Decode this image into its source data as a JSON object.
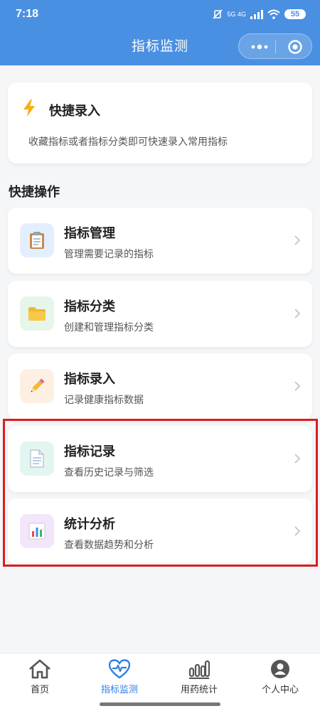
{
  "status_bar": {
    "time": "7:18",
    "network": "5G 4G",
    "battery": "55"
  },
  "header": {
    "title": "指标监测"
  },
  "quick_entry": {
    "icon": "lightning-icon",
    "title": "快捷录入",
    "description": "收藏指标或者指标分类即可快速录入常用指标"
  },
  "section_title": "快捷操作",
  "actions": [
    {
      "title": "指标管理",
      "description": "管理需要记录的指标",
      "icon": "clipboard-icon",
      "icon_bg": "#e3efff"
    },
    {
      "title": "指标分类",
      "description": "创建和管理指标分类",
      "icon": "folder-icon",
      "icon_bg": "#e6f6ea"
    },
    {
      "title": "指标录入",
      "description": "记录健康指标数据",
      "icon": "pencil-icon",
      "icon_bg": "#fdf0e3"
    },
    {
      "title": "指标记录",
      "description": "查看历史记录与筛选",
      "icon": "document-icon",
      "icon_bg": "#e3f5f0"
    },
    {
      "title": "统计分析",
      "description": "查看数据趋势和分析",
      "icon": "bar-chart-icon",
      "icon_bg": "#f3e6fb"
    }
  ],
  "tabs": [
    {
      "label": "首页",
      "icon": "home-icon",
      "active": false
    },
    {
      "label": "指标监测",
      "icon": "heart-pulse-icon",
      "active": true
    },
    {
      "label": "用药统计",
      "icon": "bar-stats-icon",
      "active": false
    },
    {
      "label": "个人中心",
      "icon": "user-icon",
      "active": false
    }
  ],
  "colors": {
    "header": "#4a90e2",
    "active_tab": "#2f7fe6",
    "highlight": "#d81e1e"
  }
}
